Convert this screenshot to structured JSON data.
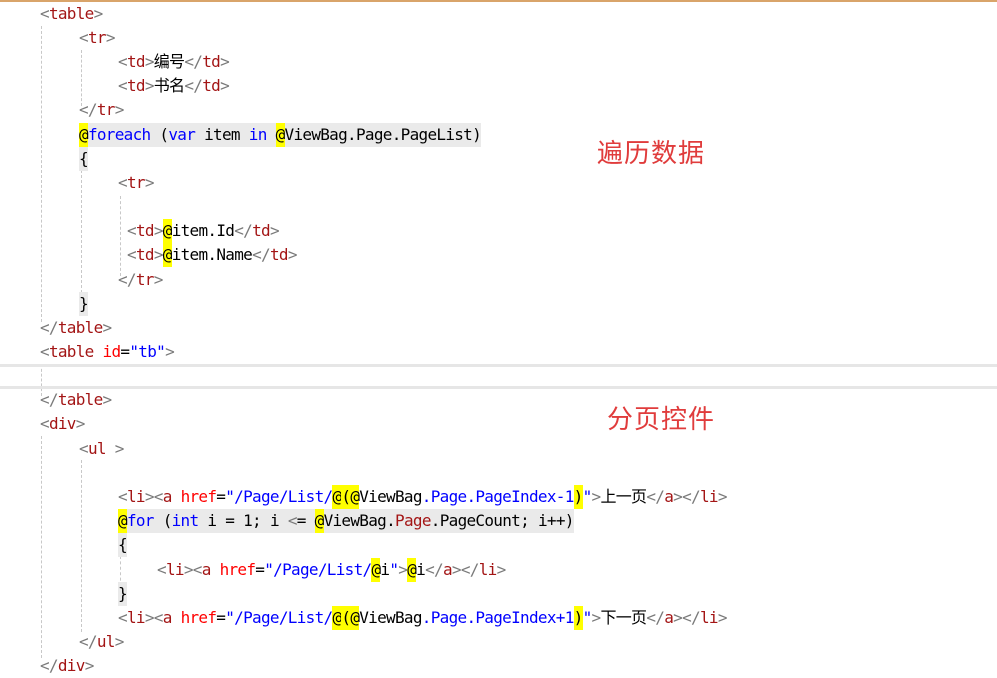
{
  "editor": {
    "lines": [
      "<table>",
      "<tr>",
      "<td>编号</td>",
      "<td>书名</td>",
      "</tr>",
      "@foreach (var item in @ViewBag.Page.PageList)",
      "{",
      "<tr>",
      "",
      "<td>@item.Id</td>",
      "<td>@item.Name</td>",
      "</tr>",
      "}",
      "</table>",
      "<table id=\"tb\">",
      "",
      "</table>",
      "<div>",
      "<ul >",
      "",
      "<li><a href=\"/Page/List/@(@ViewBag.Page.PageIndex-1)\">上一页</a></li>",
      "@for (int i = 1; i <= @ViewBag.Page.PageCount; i++)",
      "{",
      "<li><a href=\"/Page/List/@i\">@i</a></li>",
      "}",
      "<li><a href=\"/Page/List/@(@ViewBag.Page.PageIndex+1)\">下一页</a></li>",
      "</ul>",
      "</div>"
    ]
  },
  "annotations": {
    "loop_note": "遍历数据",
    "pager_note": "分页控件"
  },
  "colors": {
    "tag_bracket": "#7a7a7a",
    "element_name": "#a31515",
    "attribute": "#ff0000",
    "string": "#0000ff",
    "keyword": "#0000ff",
    "razor_highlight": "#ffff00",
    "annotation_text": "#e03c3c"
  }
}
